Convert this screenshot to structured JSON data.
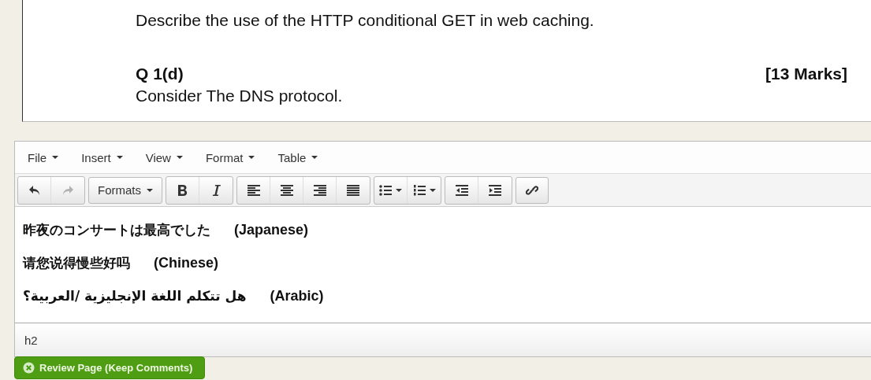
{
  "document": {
    "lines": [
      {
        "kind": "text",
        "text": "Describe the use of the HTTP conditional GET in web caching."
      },
      {
        "kind": "gap"
      },
      {
        "kind": "heading",
        "text": "Q 1(d)",
        "marks": "[13 Marks]"
      },
      {
        "kind": "text",
        "text": "Consider The DNS protocol."
      }
    ]
  },
  "editor": {
    "menus": [
      "File",
      "Insert",
      "View",
      "Format",
      "Table"
    ],
    "toolbar": [
      [
        {
          "kind": "undo",
          "disabled": false
        },
        {
          "kind": "redo",
          "disabled": true
        }
      ],
      [
        {
          "kind": "formats",
          "label": "Formats",
          "disabled": false
        }
      ],
      [
        {
          "kind": "bold",
          "disabled": false
        },
        {
          "kind": "italic",
          "disabled": false
        }
      ],
      [
        {
          "kind": "align-left",
          "disabled": false
        },
        {
          "kind": "align-center",
          "disabled": false
        },
        {
          "kind": "align-right",
          "disabled": false
        },
        {
          "kind": "justify",
          "disabled": false
        }
      ],
      [
        {
          "kind": "bullet-list",
          "disabled": false
        },
        {
          "kind": "number-list",
          "disabled": false
        }
      ],
      [
        {
          "kind": "outdent",
          "disabled": false
        },
        {
          "kind": "indent",
          "disabled": false
        }
      ],
      [
        {
          "kind": "link",
          "disabled": false
        }
      ]
    ],
    "content": [
      {
        "text": "昨夜のコンサートは最高でした",
        "language": "(Japanese)"
      },
      {
        "text": "请您说得慢些好吗",
        "language": "(Chinese)"
      },
      {
        "text": "هل تتكلم اللغة الإنجليزية /العربية؟",
        "language": "(Arabic)"
      }
    ],
    "status_path": "h2"
  },
  "review_button": {
    "label": "Review Page (Keep Comments)"
  }
}
